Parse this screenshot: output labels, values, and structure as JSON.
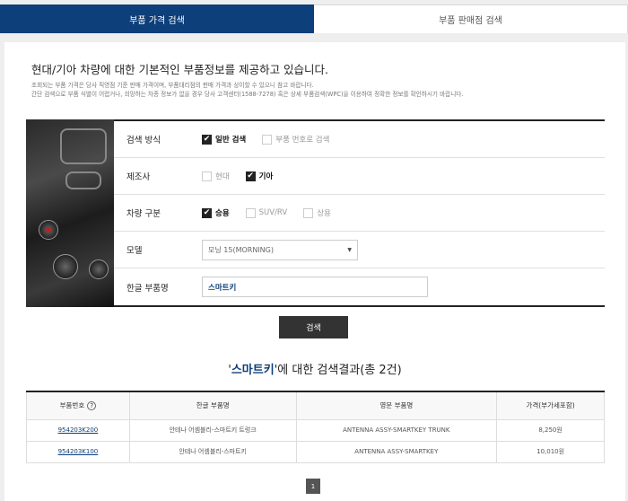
{
  "tabs": [
    {
      "label": "부품 가격 검색",
      "active": true
    },
    {
      "label": "부품 판매점 검색",
      "active": false
    }
  ],
  "headline": "현대/기아 차량에 대한 기본적인 부품정보를 제공하고 있습니다.",
  "notice": [
    "조회되는 부품 가격은 당사 직영점 기준 판매 가격이며, 부품대리점의 판매 가격과 상이할 수 있으니 참고 바랍니다.",
    "간단 검색으로 부품 식별이 어렵거나, 희망하는 차종 정보가 없을 경우 당사 고객센터(1588-7278) 혹은 상세 부품검색(WPC)을 이용하여 정확한 정보를 확인하시기 바랍니다."
  ],
  "form": {
    "search_method": {
      "label": "검색 방식",
      "options": [
        {
          "text": "일반 검색",
          "checked": true
        },
        {
          "text": "부품 번호로 검색",
          "checked": false
        }
      ]
    },
    "maker": {
      "label": "제조사",
      "options": [
        {
          "text": "현대",
          "checked": false
        },
        {
          "text": "기아",
          "checked": true
        }
      ]
    },
    "vehicle_type": {
      "label": "차량 구분",
      "options": [
        {
          "text": "승용",
          "checked": true
        },
        {
          "text": "SUV/RV",
          "checked": false
        },
        {
          "text": "상용",
          "checked": false
        }
      ]
    },
    "model": {
      "label": "모델",
      "selected": "모닝 15(MORNING)"
    },
    "part_name": {
      "label": "한글 부품명",
      "value": "스마트키"
    },
    "search_button": "검색"
  },
  "result": {
    "prefix": "'",
    "keyword": "스마트키",
    "suffix": "'에 대한 검색결과(총 2건)"
  },
  "table": {
    "headers": [
      "부품번호",
      "한글 부품명",
      "영문 부품명",
      "가격(부가세포함)"
    ],
    "help_icon": "?",
    "rows": [
      {
        "part_no": "954203K200",
        "korean": "안테나 어셈블리-스마트키 트렁크",
        "english": "ANTENNA ASSY-SMARTKEY TRUNK",
        "price": "8,250원"
      },
      {
        "part_no": "954203K100",
        "korean": "안테나 어셈블리-스마트키",
        "english": "ANTENNA ASSY-SMARTKEY",
        "price": "10,010원"
      }
    ]
  },
  "pagination": {
    "current": "1"
  },
  "colors": {
    "brand": "#0d3f7a",
    "dark": "#333333"
  }
}
